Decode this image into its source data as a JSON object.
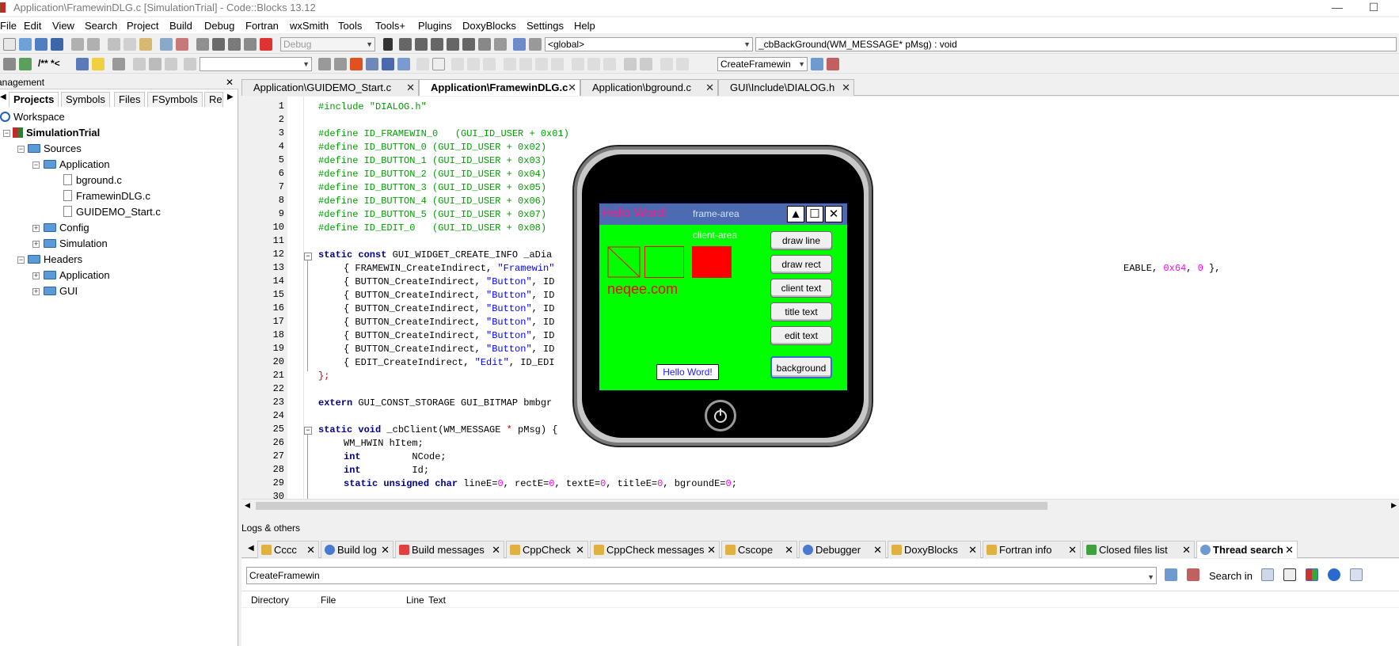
{
  "window": {
    "title": "Application\\FramewinDLG.c [SimulationTrial] - Code::Blocks 13.12",
    "minimize": "—",
    "maximize": "☐"
  },
  "menu": [
    "File",
    "Edit",
    "View",
    "Search",
    "Project",
    "Build",
    "Debug",
    "Fortran",
    "wxSmith",
    "Tools",
    "Tools+",
    "Plugins",
    "DoxyBlocks",
    "Settings",
    "Help"
  ],
  "toolbar": {
    "build_target": "Debug",
    "scope": "<global>",
    "function": "_cbBackGround(WM_MESSAGE* pMsg) : void",
    "comment_label": "/** *<",
    "search_value": "CreateFramewin"
  },
  "management": {
    "title": "Management",
    "tabs": [
      "Projects",
      "Symbols",
      "Files",
      "FSymbols",
      "Re"
    ],
    "tree": {
      "workspace": "Workspace",
      "project": "SimulationTrial",
      "sources": "Sources",
      "application": "Application",
      "files": [
        "bground.c",
        "FramewinDLG.c",
        "GUIDEMO_Start.c"
      ],
      "config": "Config",
      "simulation": "Simulation",
      "headers": "Headers",
      "h_application": "Application",
      "gui": "GUI"
    }
  },
  "editor_tabs": [
    "Application\\GUIDEMO_Start.c",
    "Application\\FramewinDLG.c",
    "Application\\bground.c",
    "GUI\\Include\\DIALOG.h"
  ],
  "code": {
    "line_numbers": [
      "1",
      "2",
      "3",
      "4",
      "5",
      "6",
      "7",
      "8",
      "9",
      "10",
      "11",
      "12",
      "13",
      "14",
      "15",
      "16",
      "17",
      "18",
      "19",
      "20",
      "21",
      "22",
      "23",
      "24",
      "25",
      "26",
      "27",
      "28",
      "29",
      "30"
    ],
    "l1": "#include \"DIALOG.h\"",
    "l3": "#define ID_FRAMEWIN_0   (GUI_ID_USER + 0x01)",
    "l4": "#define ID_BUTTON_0 (GUI_ID_USER + 0x02)",
    "l5": "#define ID_BUTTON_1 (GUI_ID_USER + 0x03)",
    "l6": "#define ID_BUTTON_2 (GUI_ID_USER + 0x04)",
    "l7": "#define ID_BUTTON_3 (GUI_ID_USER + 0x05)",
    "l8": "#define ID_BUTTON_4 (GUI_ID_USER + 0x06)",
    "l9": "#define ID_BUTTON_5 (GUI_ID_USER + 0x07)",
    "l10": "#define ID_EDIT_0   (GUI_ID_USER + 0x08)",
    "l12a": "static const",
    "l12b": " GUI_WIDGET_CREATE_INFO _aDia",
    "l13a": "{ FRAMEWIN_CreateIndirect, ",
    "l13b": "\"Framewin\"",
    "l13c": "EABLE, ",
    "l13d": "0x64",
    "l13e": ", ",
    "l13f": "0",
    "l13g": " },",
    "btn_line": "{ BUTTON_CreateIndirect, ",
    "btn_str": "\"Button\"",
    "btn_tail": ", ID",
    "l20a": "{ EDIT_CreateIndirect, ",
    "l20b": "\"Edit\"",
    "l20c": ", ID_EDI",
    "l21": "};",
    "l23a": "extern",
    "l23b": " GUI_CONST_STORAGE GUI_BITMAP bmbgr",
    "l25a": "static void",
    "l25b": " _cbClient(WM_MESSAGE ",
    "l25c": "*",
    "l25d": " pMsg) {",
    "l26": "WM_HWIN hItem;",
    "l27a": "int",
    "l27b": "         NCode;",
    "l28a": "int",
    "l28b": "         Id;",
    "l29a": "static unsigned char",
    "l29b": " lineE=",
    "l29c": "0",
    "l29d": ", rectE=",
    "l29e": ", textE=",
    "l29f": ", titleE=",
    "l29g": ", bgroundE=",
    "l29h": ";"
  },
  "simulator": {
    "frame_title": "Hello Word!",
    "frame_area": "frame-area",
    "client_area": "client-area",
    "brand": "neqee.com",
    "edit_text": "Hello Word!",
    "buttons": [
      "draw line",
      "draw rect",
      "client text",
      "title text",
      "edit text",
      "background"
    ]
  },
  "logs": {
    "title": "Logs & others",
    "tabs": [
      "Cccc",
      "Build log",
      "Build messages",
      "CppCheck",
      "CppCheck messages",
      "Cscope",
      "Debugger",
      "DoxyBlocks",
      "Fortran info",
      "Closed files list",
      "Thread search"
    ],
    "search_value": "CreateFramewin",
    "search_in": "Search in",
    "columns": [
      "Directory",
      "File",
      "Line",
      "Text"
    ]
  },
  "colors": {
    "green": "#00ff00",
    "red": "#ff0000",
    "pink": "#ff1a8c",
    "code_green": "#00a000",
    "keyword": "#00008b"
  }
}
